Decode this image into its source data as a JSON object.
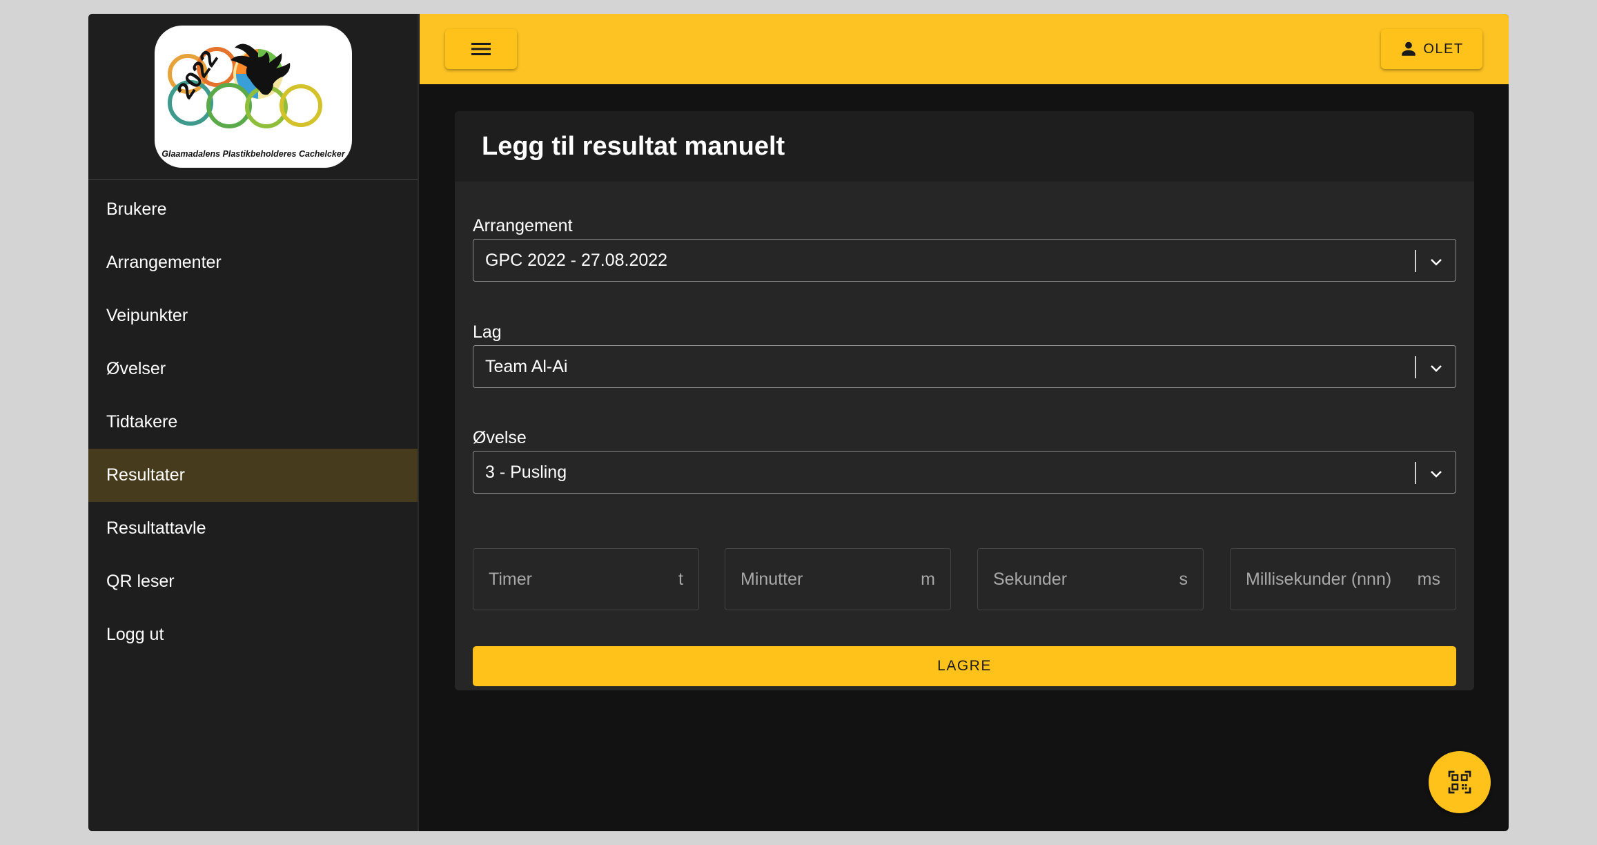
{
  "brand": {
    "logo_year": "2022",
    "logo_caption": "Glaamadalens Plastikbeholderes Cachelcker"
  },
  "sidebar": {
    "items": [
      {
        "label": "Brukere",
        "active": false
      },
      {
        "label": "Arrangementer",
        "active": false
      },
      {
        "label": "Veipunkter",
        "active": false
      },
      {
        "label": "Øvelser",
        "active": false
      },
      {
        "label": "Tidtakere",
        "active": false
      },
      {
        "label": "Resultater",
        "active": true
      },
      {
        "label": "Resultattavle",
        "active": false
      },
      {
        "label": "QR leser",
        "active": false
      },
      {
        "label": "Logg ut",
        "active": false
      }
    ]
  },
  "topbar": {
    "menu_icon": "hamburger-menu-icon",
    "user_icon": "person-icon",
    "user_label": "OLET"
  },
  "form": {
    "title": "Legg til resultat manuelt",
    "arrangement": {
      "label": "Arrangement",
      "value": "GPC 2022 - 27.08.2022"
    },
    "lag": {
      "label": "Lag",
      "value": "Team Al-Ai"
    },
    "ovelse": {
      "label": "Øvelse",
      "value": "3 - Pusling"
    },
    "time_fields": [
      {
        "placeholder": "Timer",
        "unit": "t"
      },
      {
        "placeholder": "Minutter",
        "unit": "m"
      },
      {
        "placeholder": "Sekunder",
        "unit": "s"
      },
      {
        "placeholder": "Millisekunder (nnn)",
        "unit": "ms"
      }
    ],
    "save_label": "LAGRE"
  },
  "fab": {
    "icon": "qr-scan-icon"
  },
  "colors": {
    "accent": "#ffc21b",
    "sidebar_bg": "#1e1e1e",
    "active_item_bg": "#463c1d",
    "app_bg": "#121212",
    "card_bg": "#262626"
  }
}
